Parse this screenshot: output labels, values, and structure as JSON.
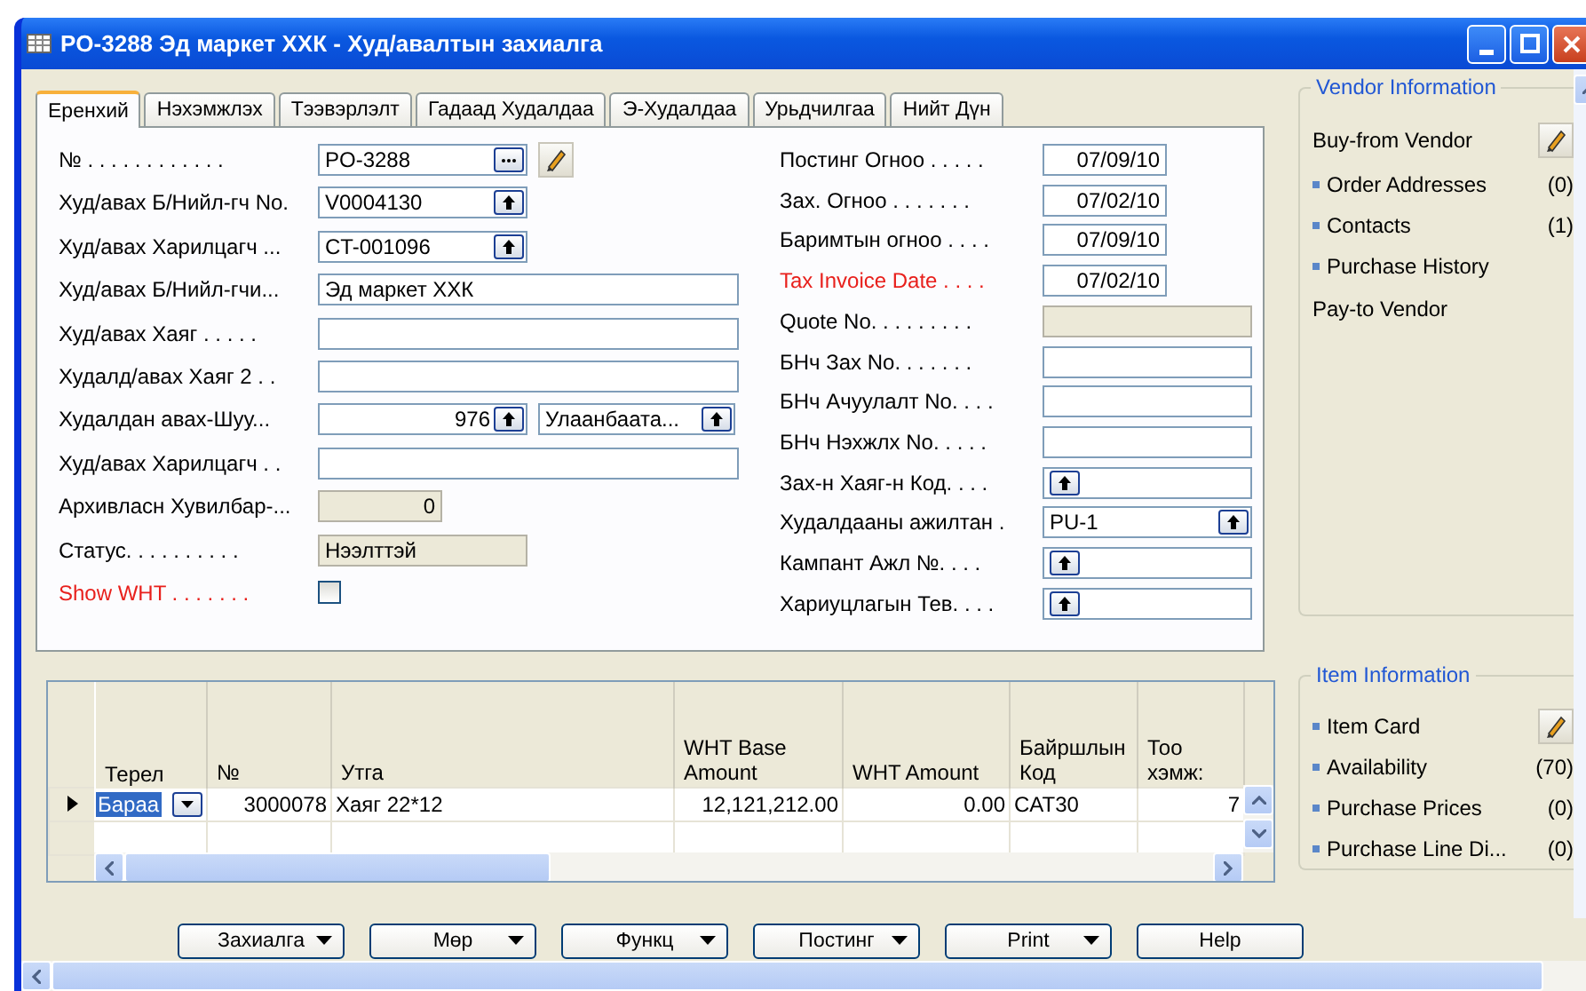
{
  "window": {
    "title": "PO-3288 Эд маркет ХХК - Худ/авалтын захиалга"
  },
  "tabs": [
    {
      "label": "Еренхий",
      "selected": true
    },
    {
      "label": "Нэхэмжлэх",
      "selected": false
    },
    {
      "label": "Тээвэрлэлт",
      "selected": false
    },
    {
      "label": "Гадаад Худалдаа",
      "selected": false
    },
    {
      "label": "Э-Худалдаа",
      "selected": false
    },
    {
      "label": "Урьдчилгаа",
      "selected": false
    },
    {
      "label": "Нийт Дүн",
      "selected": false
    }
  ],
  "left_fields": [
    {
      "label": "№ . . . . . . . . . . . .",
      "kind": "assist",
      "value": "PO-3288",
      "highlighted": false
    },
    {
      "label": "Худ/авах Б/Нийл-гч No.",
      "kind": "lookup",
      "value": "V0004130",
      "highlighted": false
    },
    {
      "label": "Худ/авах Харилцагч ...",
      "kind": "lookup",
      "value": "CT-001096",
      "highlighted": false
    },
    {
      "label": "Худ/авах Б/Нийл-гчи...",
      "kind": "wide",
      "value": "Эд маркет ХХК",
      "highlighted": false
    },
    {
      "label": "Худ/авах Хаяг . . . . .",
      "kind": "wide",
      "highlighted": false
    },
    {
      "label": "Худалд/авах Хаяг 2 . .",
      "kind": "wide",
      "highlighted": false
    },
    {
      "label": "Худалдан авах-Шуу...",
      "kind": "pair",
      "value": "976",
      "value2": "Улаанбаата...",
      "highlighted": false
    },
    {
      "label": "Худ/авах Харилцагч . .",
      "kind": "wide",
      "highlighted": false
    },
    {
      "label": "Архивласн Хувилбар-...",
      "kind": "number_readonly",
      "value": "0",
      "highlighted": false
    },
    {
      "label": "Статус. . . . . . . . . .",
      "kind": "readonly",
      "value": "Нээлттэй",
      "highlighted": false
    },
    {
      "label": "Show WHT . . . . . . .",
      "kind": "checkbox",
      "checked": false,
      "highlighted": true
    }
  ],
  "right_fields": [
    {
      "label": "Постинг Огноо . . . . .",
      "kind": "date",
      "value": "07/09/10",
      "highlighted": false
    },
    {
      "label": "Зах. Огноо . . . . . . .",
      "kind": "date",
      "value": "07/02/10",
      "highlighted": false
    },
    {
      "label": "Баримтын огноо . . . .",
      "kind": "date",
      "value": "07/09/10",
      "highlighted": false
    },
    {
      "label": "Tax Invoice Date . . . .",
      "kind": "date",
      "value": "07/02/10",
      "highlighted": true
    },
    {
      "label": "Quote No. . . . . . . . .",
      "kind": "readonly",
      "highlighted": false
    },
    {
      "label": "БНч Зах No. . . . . . .",
      "kind": "wide",
      "highlighted": false
    },
    {
      "label": "БНч Ачуулалт No. . . .",
      "kind": "wide",
      "highlighted": false
    },
    {
      "label": "БНч Нэхжлх No. . . . .",
      "kind": "wide",
      "highlighted": false
    },
    {
      "label": "Зах-н Хаяг-н Код. . . .",
      "kind": "lookup",
      "highlighted": false
    },
    {
      "label": "Худалдааны ажилтан .",
      "kind": "lookup",
      "value": "PU-1",
      "highlighted": false
    },
    {
      "label": "Кампант Ажл №. . . .",
      "kind": "lookup",
      "highlighted": false
    },
    {
      "label": "Хариуцлагын Тев. . . .",
      "kind": "lookup",
      "highlighted": false
    }
  ],
  "lines": {
    "columns": [
      "Терел",
      "№",
      "Утга",
      "WHT Base Amount",
      "WHT Amount",
      "Байршлын Код",
      "Тоо хэмж:"
    ],
    "rows": [
      {
        "current": true,
        "cells": [
          "Бараа",
          "3000078",
          "Хаяг 22*12",
          "12,121,212.00",
          "0.00",
          "CAT30",
          "7"
        ]
      }
    ]
  },
  "vendor_information": {
    "title": "Vendor Information",
    "items": [
      {
        "kind": "heading",
        "label": "Buy-from Vendor",
        "edit": true
      },
      {
        "kind": "link",
        "label": "Order Addresses",
        "count": "(0)"
      },
      {
        "kind": "link",
        "label": "Contacts",
        "count": "(1)"
      },
      {
        "kind": "link",
        "label": "Purchase History"
      },
      {
        "kind": "heading",
        "label": "Pay-to Vendor",
        "edit": false
      }
    ]
  },
  "item_information": {
    "title": "Item Information",
    "items": [
      {
        "kind": "link",
        "label": "Item Card",
        "edit": true
      },
      {
        "kind": "link",
        "label": "Availability",
        "count": "(70)"
      },
      {
        "kind": "link",
        "label": "Purchase Prices",
        "count": "(0)"
      },
      {
        "kind": "link",
        "label": "Purchase Line Di...",
        "count": "(0)"
      }
    ]
  },
  "buttons": [
    {
      "label": "Захиалга",
      "dropdown": true
    },
    {
      "label": "Мөр",
      "dropdown": true
    },
    {
      "label": "Функц",
      "dropdown": true
    },
    {
      "label": "Постинг",
      "dropdown": true
    },
    {
      "label": "Print",
      "dropdown": true
    },
    {
      "label": "Help",
      "dropdown": false
    }
  ]
}
